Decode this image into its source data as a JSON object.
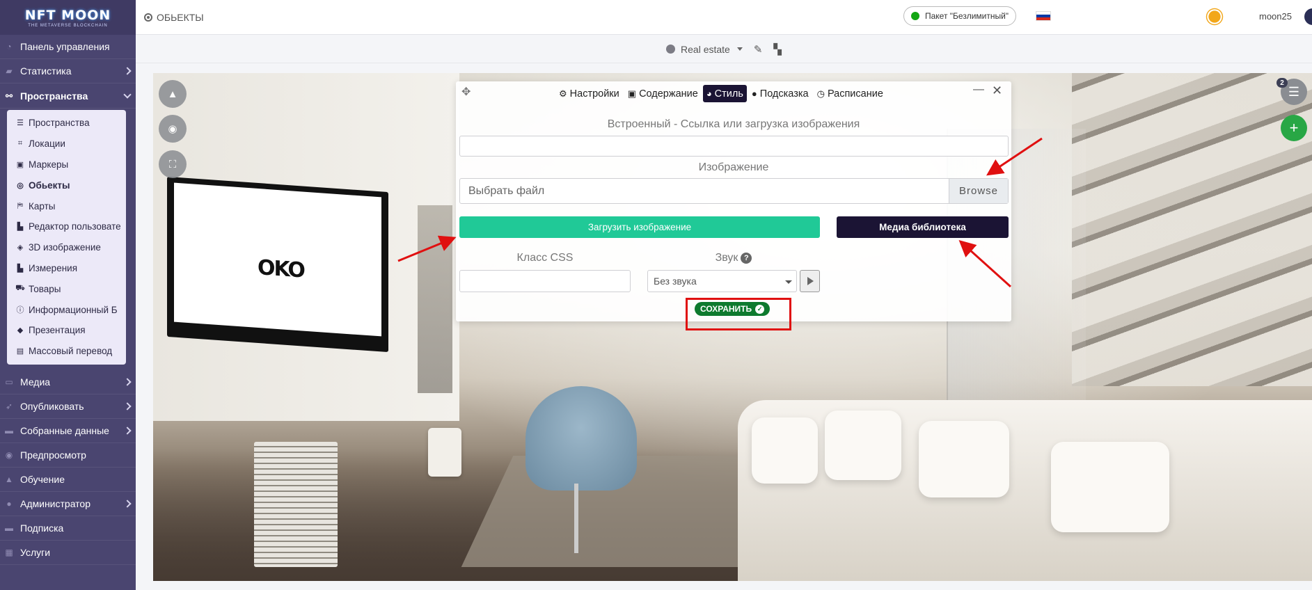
{
  "logo": {
    "title": "NFT MOON",
    "subtitle": "THE METAVERSE BLOCKCHAIN"
  },
  "sidebar": {
    "items": [
      {
        "label": "Панель управления",
        "icon": "dashboard-icon"
      },
      {
        "label": "Статистика",
        "icon": "chart-icon",
        "chevron": true
      },
      {
        "label": "Пространства",
        "icon": "spaces-icon",
        "chevron": true,
        "open": true
      }
    ],
    "submenu": [
      {
        "label": "Пространства",
        "icon": "list-icon"
      },
      {
        "label": "Локации",
        "icon": "location-icon"
      },
      {
        "label": "Маркеры",
        "icon": "marker-icon"
      },
      {
        "label": "Обьекты",
        "icon": "target-icon",
        "active": true
      },
      {
        "label": "Карты",
        "icon": "map-icon"
      },
      {
        "label": "Редактор пользовате",
        "icon": "editor-icon"
      },
      {
        "label": "3D изображение",
        "icon": "cube-icon"
      },
      {
        "label": "Измерения",
        "icon": "ruler-icon"
      },
      {
        "label": "Товары",
        "icon": "cart-icon"
      },
      {
        "label": "Информационный Б",
        "icon": "info-icon"
      },
      {
        "label": "Презентация",
        "icon": "presentation-icon"
      },
      {
        "label": "Массовый перевод",
        "icon": "translate-icon"
      }
    ],
    "bottom_items": [
      {
        "label": "Медиа",
        "icon": "media-icon",
        "chevron": true
      },
      {
        "label": "Опубликовать",
        "icon": "publish-icon",
        "chevron": true
      },
      {
        "label": "Собранные данные",
        "icon": "data-icon",
        "chevron": true
      },
      {
        "label": "Предпросмотр",
        "icon": "preview-icon"
      },
      {
        "label": "Обучение",
        "icon": "learn-icon"
      },
      {
        "label": "Администратор",
        "icon": "admin-icon",
        "chevron": true
      },
      {
        "label": "Подписка",
        "icon": "subscription-icon"
      },
      {
        "label": "Услуги",
        "icon": "services-icon"
      }
    ]
  },
  "topbar": {
    "breadcrumb": "ОБЬЕКТЫ",
    "package": "Пакет \"Безлимитный\"",
    "username": "moon25",
    "flag_colors": [
      "#ffffff",
      "#0039a6",
      "#d52b1e"
    ]
  },
  "subbar": {
    "space_name": "Real estate"
  },
  "viewer": {
    "badge_count": "2"
  },
  "dialog": {
    "tabs": [
      {
        "label": "Настройки",
        "icon": "gear-icon"
      },
      {
        "label": "Содержание",
        "icon": "content-icon"
      },
      {
        "label": "Стиль",
        "icon": "palette-icon",
        "active": true
      },
      {
        "label": "Подсказка",
        "icon": "comment-icon"
      },
      {
        "label": "Расписание",
        "icon": "clock-icon"
      }
    ],
    "embed_label": "Встроенный - Ссылка или загрузка изображения",
    "embed_value": "",
    "image_label": "Изображение",
    "file_placeholder": "Выбрать файл",
    "browse_label": "Browse",
    "upload_button": "Загрузить изображение",
    "media_button": "Медиа библиотека",
    "css_label": "Класс CSS",
    "css_value": "",
    "sound_label": "Звук",
    "sound_value": "Без звука",
    "save_button": "СОХРАНИТЬ"
  },
  "tv_text": "OKO",
  "colors": {
    "accent_green": "#20c997",
    "dark": "#1b1434",
    "annotation_red": "#e01010",
    "sidebar": "#4a4570"
  }
}
